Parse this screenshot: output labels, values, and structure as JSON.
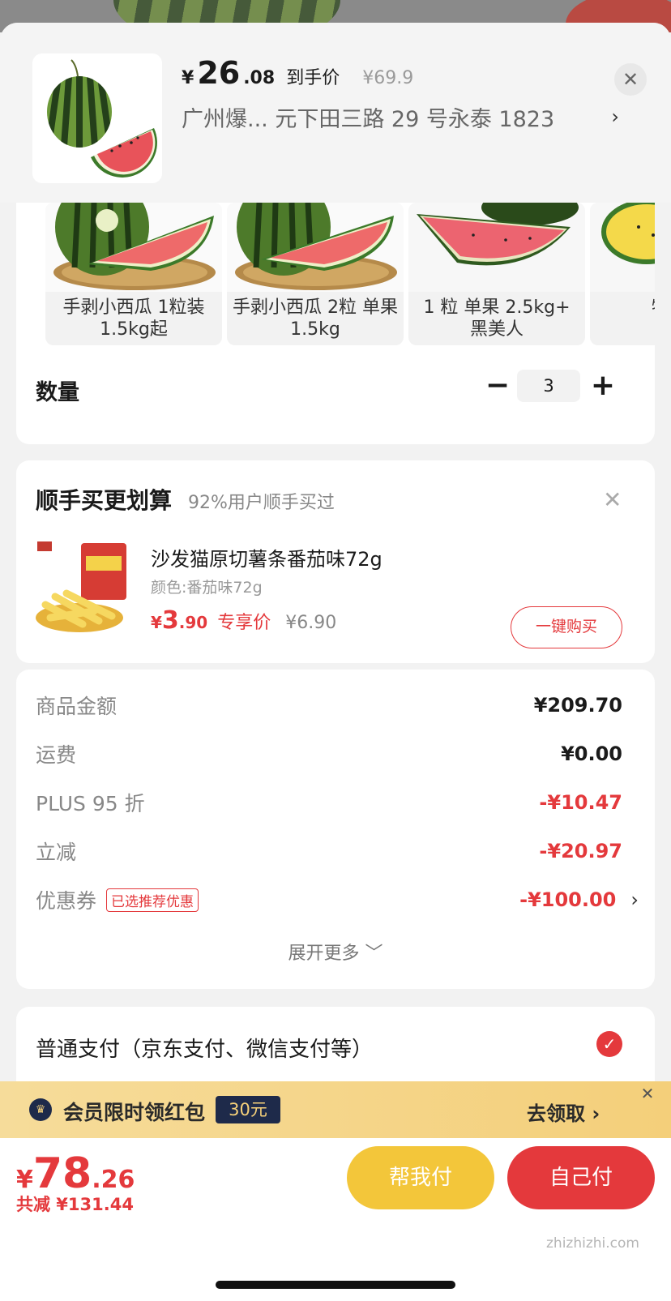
{
  "header": {
    "price_yen": "¥",
    "price_int": "26",
    "price_dec": ".08",
    "price_label": "到手价",
    "price_orig": "¥69.9",
    "address": "广州爆...  元下田三路 29 号永泰 1823",
    "address_chevron": "›",
    "close_symbol": "✕"
  },
  "spec": {
    "variants": [
      {
        "label": "手剥小西瓜 1粒装 1.5kg起"
      },
      {
        "label": "手剥小西瓜 2粒 单果1.5kg"
      },
      {
        "label": "1 粒 单果 2.5kg+ 黑美人"
      },
      {
        "label": "特小凤"
      }
    ],
    "quantity_label": "数量",
    "quantity_value": "3",
    "minus_symbol": "−",
    "plus_symbol": "+"
  },
  "upsell": {
    "title": "顺手买更划算",
    "subtitle": "92%用户顺手买过",
    "close_symbol": "✕",
    "product_name": "沙发猫原切薯条番茄味72g",
    "product_color": "颜色:番茄味72g",
    "price_yen": "¥",
    "price_int": "3",
    "price_dec": ".90",
    "price_label": "专享价",
    "price_orig": "¥6.90",
    "buy_button": "一键购买"
  },
  "summary": {
    "rows": [
      {
        "label": "商品金额",
        "value": "¥209.70"
      },
      {
        "label": "运费",
        "value": "¥0.00"
      },
      {
        "label": "PLUS 95 折",
        "value": "-¥10.47"
      },
      {
        "label": "立减",
        "value": "-¥20.97"
      },
      {
        "label": "优惠券",
        "value": "-¥100.00"
      }
    ],
    "coupon_tag": "已选推荐优惠",
    "coupon_chevron": "›",
    "expand": "展开更多 ﹀"
  },
  "payment": {
    "label": "普通支付（京东支付、微信支付等）",
    "check_symbol": "✓"
  },
  "promo": {
    "icon_symbol": "♛",
    "text": "会员限时领红包",
    "badge": "30元",
    "action": "去领取 ›",
    "close_symbol": "✕"
  },
  "bottom": {
    "total_yen": "¥",
    "total_int": "78",
    "total_dec": ".26",
    "saved": "共减 ¥131.44",
    "help_button": "帮我付",
    "self_button": "自己付",
    "watermark": "zhizhizhi.com"
  },
  "colors": {
    "accent_red": "#e4393c",
    "help_yellow": "#f3c63a",
    "promo_navy": "#1e2a4a"
  }
}
